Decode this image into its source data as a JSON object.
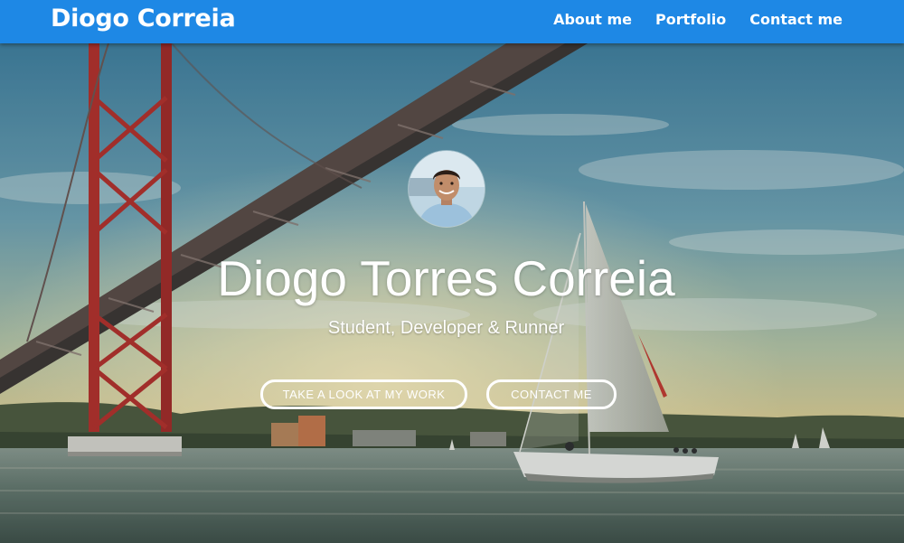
{
  "navbar": {
    "brand": "Diogo Correia",
    "links": [
      "About me",
      "Portfolio",
      "Contact me"
    ],
    "background_color": "#1e88e5"
  },
  "hero": {
    "name": "Diogo Torres Correia",
    "tagline": "Student, Developer & Runner",
    "buttons": [
      "TAKE A LOOK AT MY WORK",
      "CONTACT ME"
    ]
  }
}
